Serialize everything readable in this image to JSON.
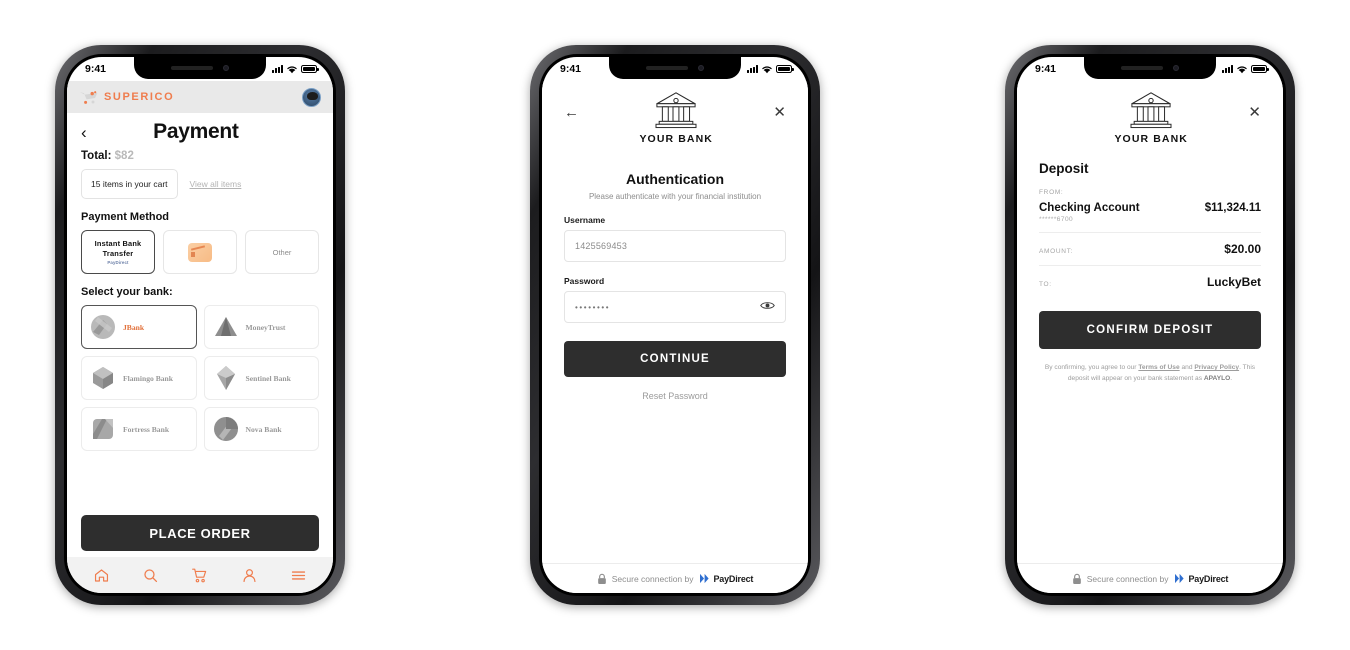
{
  "statusbar": {
    "time": "9:41"
  },
  "phone1": {
    "brand": "SUPERICO",
    "page_title": "Payment",
    "back_icon": "chevron-left-icon",
    "total_label": "Total:",
    "total_amount": "$82",
    "cart_summary": "15 items in your cart",
    "view_all_items": "View all items",
    "payment_method_label": "Payment Method",
    "methods": [
      {
        "title": "Instant Bank Transfer",
        "sub": "PayDirect",
        "type": "text",
        "selected": true
      },
      {
        "title": "",
        "sub": "",
        "type": "card",
        "selected": false
      },
      {
        "title": "Other",
        "sub": "",
        "type": "other",
        "selected": false
      }
    ],
    "select_bank_label": "Select your bank:",
    "banks": [
      {
        "name": "JBank",
        "selected": true
      },
      {
        "name": "MoneyTrust",
        "selected": false
      },
      {
        "name": "Flamingo Bank",
        "selected": false
      },
      {
        "name": "Sentinel Bank",
        "selected": false
      },
      {
        "name": "Fortress Bank",
        "selected": false
      },
      {
        "name": "Nova Bank",
        "selected": false
      }
    ],
    "place_order": "PLACE ORDER",
    "tabs": [
      {
        "icon": "home-icon",
        "name": "tab-home"
      },
      {
        "icon": "search-icon",
        "name": "tab-search"
      },
      {
        "icon": "cart-icon",
        "name": "tab-cart"
      },
      {
        "icon": "person-icon",
        "name": "tab-account"
      },
      {
        "icon": "menu-icon",
        "name": "tab-menu"
      }
    ],
    "accent_color": "#ef7d4e"
  },
  "phone2": {
    "bank_name": "YOUR BANK",
    "back_icon": "arrow-left-icon",
    "close_icon": "close-icon",
    "title": "Authentication",
    "subtitle": "Please authenticate with your financial institution",
    "username_label": "Username",
    "username_value": "1425569453",
    "password_label": "Password",
    "password_value": "••••••••",
    "password_toggle_icon": "eye-icon",
    "continue_label": "CONTINUE",
    "reset_label": "Reset Password",
    "footer_text": "Secure connection by",
    "footer_brand": "PayDirect",
    "footer_icon": "lock-icon"
  },
  "phone3": {
    "bank_name": "YOUR BANK",
    "close_icon": "close-icon",
    "title": "Deposit",
    "from_label": "FROM:",
    "account_name": "Checking Account",
    "account_balance": "$11,324.11",
    "account_mask": "******6700",
    "amount_label": "AMOUNT:",
    "amount_value": "$20.00",
    "to_label": "TO:",
    "to_value": "LuckyBet",
    "confirm_label": "CONFIRM DEPOSIT",
    "terms_prefix": "By confirming, you agree to our",
    "terms_link1": "Terms of Use",
    "terms_and": "and",
    "terms_link2": "Privacy Policy",
    "terms_mid": ". This deposit will appear on your bank statement as",
    "terms_statement": "APAYLO",
    "terms_end": ".",
    "footer_text": "Secure connection by",
    "footer_brand": "PayDirect",
    "footer_icon": "lock-icon"
  }
}
